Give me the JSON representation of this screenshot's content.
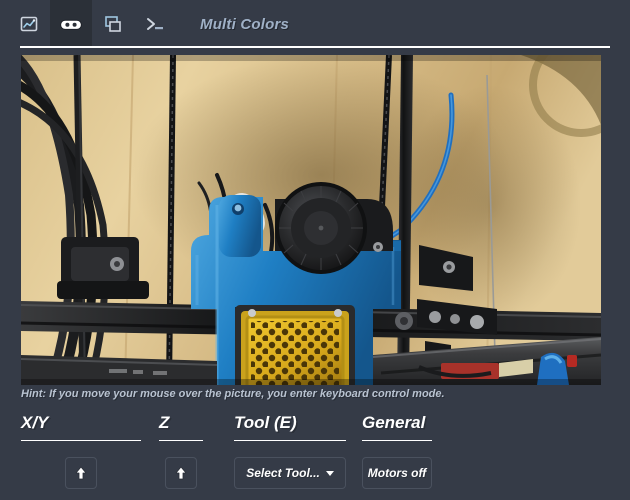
{
  "header": {
    "tabs": [
      {
        "name": "tab-temperature",
        "icon": "chart-icon",
        "label": "Temperature",
        "active": false
      },
      {
        "name": "tab-control",
        "icon": "gamepad-icon",
        "label": "Control",
        "active": true
      },
      {
        "name": "tab-gcode-viewer",
        "icon": "windows-icon",
        "label": "GCode Viewer",
        "active": false
      },
      {
        "name": "tab-terminal",
        "icon": "terminal-icon",
        "label": "Terminal",
        "active": false
      }
    ],
    "title": "Multi Colors"
  },
  "webcam": {
    "alt": "Live webcam view of a 3D printer: blue printed fan shroud, black blower fan and yellow honeycomb fan grille over the heated bed, black aluminium frame, yellow-beige wall background.",
    "hint": "Hint: If you move your mouse over the picture, you enter keyboard control mode."
  },
  "controls": {
    "sections": [
      {
        "name": "xy",
        "title": "X/Y",
        "buttons": [
          {
            "name": "jog-y-plus-button",
            "label": "",
            "icon": "arrow-up-icon"
          }
        ]
      },
      {
        "name": "z",
        "title": "Z",
        "buttons": [
          {
            "name": "jog-z-plus-button",
            "label": "",
            "icon": "arrow-up-icon"
          }
        ]
      },
      {
        "name": "tool",
        "title": "Tool (E)",
        "buttons": [
          {
            "name": "select-tool-dropdown",
            "label": "Select Tool...",
            "icon": "caret-down-icon"
          }
        ]
      },
      {
        "name": "general",
        "title": "General",
        "buttons": [
          {
            "name": "motors-off-button",
            "label": "Motors off",
            "icon": ""
          }
        ]
      }
    ]
  },
  "colors": {
    "app_background": "#353b47",
    "active_tab_background": "#2b3038",
    "title_text": "#9fb0c6",
    "heading_text": "#ffffff",
    "hint_text": "#b9c3d1",
    "button_border": "#4a515e"
  }
}
